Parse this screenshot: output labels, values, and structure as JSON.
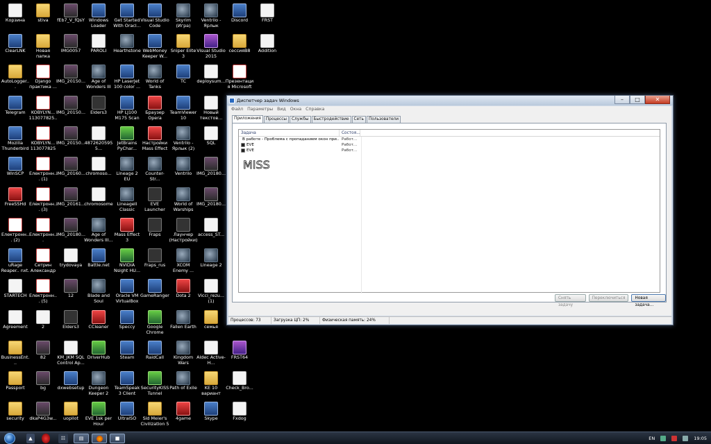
{
  "desktop": {
    "icons": [
      {
        "label": "Корзина",
        "kind": "k-file"
      },
      {
        "label": "stiva",
        "kind": "k-folder"
      },
      {
        "label": "fEb7_V_fQsY",
        "kind": "k-img"
      },
      {
        "label": "Windows Loader",
        "kind": "k-exe"
      },
      {
        "label": "Get Started With Oracl...",
        "kind": "k-exe"
      },
      {
        "label": "Visual Studio Code",
        "kind": "k-exe"
      },
      {
        "label": "Skyrim (Игра)",
        "kind": "k-game"
      },
      {
        "label": "Ventrilo - Ярлык",
        "kind": "k-game"
      },
      {
        "label": "Discord",
        "kind": "k-exe"
      },
      {
        "label": "FRST",
        "kind": "k-file"
      },
      {
        "label": "ClearLNK",
        "kind": "k-exe"
      },
      {
        "label": "Новая папка",
        "kind": "k-folder"
      },
      {
        "label": "IMG0057",
        "kind": "k-img"
      },
      {
        "label": "PAROLI",
        "kind": "k-file"
      },
      {
        "label": "Hearthstone",
        "kind": "k-game"
      },
      {
        "label": "WebMoney Keeper W...",
        "kind": "k-exe"
      },
      {
        "label": "Sniper Elite 3",
        "kind": "k-folder"
      },
      {
        "label": "Visual Studio 2015",
        "kind": "k-purple"
      },
      {
        "label": "сессияВ8",
        "kind": "k-folder"
      },
      {
        "label": "Addition",
        "kind": "k-file"
      },
      {
        "label": "AutoLogger...",
        "kind": "k-folder"
      },
      {
        "label": "Django практика ...",
        "kind": "k-pdf"
      },
      {
        "label": "IMG_20150...",
        "kind": "k-img"
      },
      {
        "label": "Age of Wonders III",
        "kind": "k-game"
      },
      {
        "label": "HP LaserJet 100 color ...",
        "kind": "k-exe"
      },
      {
        "label": "World of Tanks",
        "kind": "k-game"
      },
      {
        "label": "TC",
        "kind": "k-exe"
      },
      {
        "label": "deploysum...",
        "kind": "k-file"
      },
      {
        "label": "Презентация Microsoft ...",
        "kind": "k-pdf"
      },
      {
        "label": "Telegram",
        "kind": "k-exe"
      },
      {
        "label": "KOBYLYN... 113077825...",
        "kind": "k-pdf"
      },
      {
        "label": "IMG_20150...",
        "kind": "k-img"
      },
      {
        "label": "Elders3",
        "kind": "k-dark"
      },
      {
        "label": "HP LJ100 M175 Scan",
        "kind": "k-exe"
      },
      {
        "label": "Браузер Opera",
        "kind": "k-red"
      },
      {
        "label": "TeamViewer 10",
        "kind": "k-exe"
      },
      {
        "label": "Новый текстов...",
        "kind": "k-file"
      },
      {
        "label": "Mozilla Thunderbird",
        "kind": "k-exe"
      },
      {
        "label": "KOBYLYN... 113077825",
        "kind": "k-pdf"
      },
      {
        "label": "IMG_20150...",
        "kind": "k-img"
      },
      {
        "label": "48726205955...",
        "kind": "k-file"
      },
      {
        "label": "JetBrains PyChar...",
        "kind": "k-green"
      },
      {
        "label": "Настройки Mass Effect 3",
        "kind": "k-red"
      },
      {
        "label": "Ventrilo - Ярлык (2)",
        "kind": "k-game"
      },
      {
        "label": "SQL",
        "kind": "k-file"
      },
      {
        "label": "WinSCP",
        "kind": "k-exe"
      },
      {
        "label": "Електронн... (1)",
        "kind": "k-pdf"
      },
      {
        "label": "IMG_20160...",
        "kind": "k-img"
      },
      {
        "label": "chromoso...",
        "kind": "k-file"
      },
      {
        "label": "Lineage 2 EU",
        "kind": "k-game"
      },
      {
        "label": "Counter-Str...",
        "kind": "k-game"
      },
      {
        "label": "Ventrilo",
        "kind": "k-game"
      },
      {
        "label": "IMG_20180...",
        "kind": "k-img"
      },
      {
        "label": "FreeSSHd",
        "kind": "k-red"
      },
      {
        "label": "Електронн... (3)",
        "kind": "k-pdf"
      },
      {
        "label": "IMG_20161...",
        "kind": "k-img"
      },
      {
        "label": "chromosome",
        "kind": "k-file"
      },
      {
        "label": "LineageII Classic",
        "kind": "k-game"
      },
      {
        "label": "EVE Launcher",
        "kind": "k-dark"
      },
      {
        "label": "World of Warships",
        "kind": "k-game"
      },
      {
        "label": "IMG_20180...",
        "kind": "k-img"
      },
      {
        "label": "Електронн... (2)",
        "kind": "k-pdf"
      },
      {
        "label": "Електронн...",
        "kind": "k-pdf"
      },
      {
        "label": "IMG_20180...",
        "kind": "k-img"
      },
      {
        "label": "Age of Wonders III...",
        "kind": "k-game"
      },
      {
        "label": "Mass Effect 3",
        "kind": "k-red"
      },
      {
        "label": "Fraps",
        "kind": "k-dark"
      },
      {
        "label": "Лаунчер (Настройки)",
        "kind": "k-dark"
      },
      {
        "label": "access_ST...",
        "kind": "k-file"
      },
      {
        "label": "uRage Reaper.. nxt.",
        "kind": "k-exe"
      },
      {
        "label": "Сетрин Александр ...",
        "kind": "k-pdf"
      },
      {
        "label": "trydovaya",
        "kind": "k-file"
      },
      {
        "label": "Battle.net",
        "kind": "k-exe"
      },
      {
        "label": "NVIDIA Nsight HU...",
        "kind": "k-green"
      },
      {
        "label": "Fraps_rus",
        "kind": "k-dark"
      },
      {
        "label": "XCOM Enemy ...",
        "kind": "k-game"
      },
      {
        "label": "Lineage 2",
        "kind": "k-game"
      },
      {
        "label": "STARTECH",
        "kind": "k-file"
      },
      {
        "label": "Електронн... (5)",
        "kind": "k-pdf"
      },
      {
        "label": "12",
        "kind": "k-img"
      },
      {
        "label": "Blade and Soul",
        "kind": "k-game"
      },
      {
        "label": "Oracle VM VirtualBox",
        "kind": "k-exe"
      },
      {
        "label": "GameRanger",
        "kind": "k-exe"
      },
      {
        "label": "Dota 2",
        "kind": "k-red"
      },
      {
        "label": "Vicci_rezu... (1)",
        "kind": "k-file"
      },
      {
        "label": "Agreement",
        "kind": "k-file"
      },
      {
        "label": "2",
        "kind": "k-file"
      },
      {
        "label": "Elders3",
        "kind": "k-dark"
      },
      {
        "label": "CCleaner",
        "kind": "k-red"
      },
      {
        "label": "Speccy",
        "kind": "k-exe"
      },
      {
        "label": "Google Chrome",
        "kind": "k-green"
      },
      {
        "label": "Fallen Earth",
        "kind": "k-game"
      },
      {
        "label": "семья",
        "kind": "k-folder"
      },
      {
        "label": "BusinessEnt...",
        "kind": "k-folder"
      },
      {
        "label": "82",
        "kind": "k-img"
      },
      {
        "label": "KM_JKM SQL Control Ap...",
        "kind": "k-file"
      },
      {
        "label": "DriverHub",
        "kind": "k-green"
      },
      {
        "label": "Steam",
        "kind": "k-exe"
      },
      {
        "label": "RaidCall",
        "kind": "k-exe"
      },
      {
        "label": "Kingdom Wars",
        "kind": "k-game"
      },
      {
        "label": "Aldec Active-H...",
        "kind": "k-file"
      },
      {
        "label": "FRST64",
        "kind": "k-purple"
      },
      {
        "label": "Passport",
        "kind": "k-folder"
      },
      {
        "label": "bg",
        "kind": "k-img"
      },
      {
        "label": "dxwebsetup",
        "kind": "k-exe"
      },
      {
        "label": "Dungeon Keeper 2",
        "kind": "k-game"
      },
      {
        "label": "TeamSpeak 3 Client",
        "kind": "k-exe"
      },
      {
        "label": "SecurityKISS Tunnel",
        "kind": "k-green"
      },
      {
        "label": "Path of Exile",
        "kind": "k-game"
      },
      {
        "label": "KE 10 вариант",
        "kind": "k-folder"
      },
      {
        "label": "Check_Bro...",
        "kind": "k-file"
      },
      {
        "label": "security",
        "kind": "k-folder"
      },
      {
        "label": "dkaP4G3w...",
        "kind": "k-img"
      },
      {
        "label": "uopilot",
        "kind": "k-folder"
      },
      {
        "label": "EVE 1sk per Hour",
        "kind": "k-green"
      },
      {
        "label": "UltraISO",
        "kind": "k-exe"
      },
      {
        "label": "Sid Meier's Civilization 5",
        "kind": "k-folder"
      },
      {
        "label": "4game",
        "kind": "k-red"
      },
      {
        "label": "Skype",
        "kind": "k-exe"
      },
      {
        "label": "Fxdog",
        "kind": "k-file"
      }
    ]
  },
  "taskmanager": {
    "title": "Диспетчер задач Windows",
    "menu": [
      "Файл",
      "Параметры",
      "Вид",
      "Окна",
      "Справка"
    ],
    "tabs": [
      "Приложения",
      "Процессы",
      "Службы",
      "Быстродействие",
      "Сеть",
      "Пользователи"
    ],
    "columns": {
      "task": "Задача",
      "status": "Состоя..."
    },
    "rows": [
      {
        "task": "В работе - Проблема с пропаданием окон при...",
        "status": "Работ...",
        "icon": "ri-fox"
      },
      {
        "task": "EVE",
        "status": "Работ...",
        "icon": "ri-eve"
      },
      {
        "task": "EVE",
        "status": "Работ...",
        "icon": "ri-eve"
      }
    ],
    "handwriting": "MISS",
    "buttons": {
      "end_task": "Снять задачу",
      "switch_to": "Переключиться",
      "new_task": "Новая задача..."
    },
    "status": {
      "processes": "Процессов: 73",
      "cpu": "Загрузка ЦП: 2%",
      "memory": "Физическая память: 24%"
    }
  },
  "taskbar": {
    "language": "EN",
    "clock": "19:05"
  }
}
